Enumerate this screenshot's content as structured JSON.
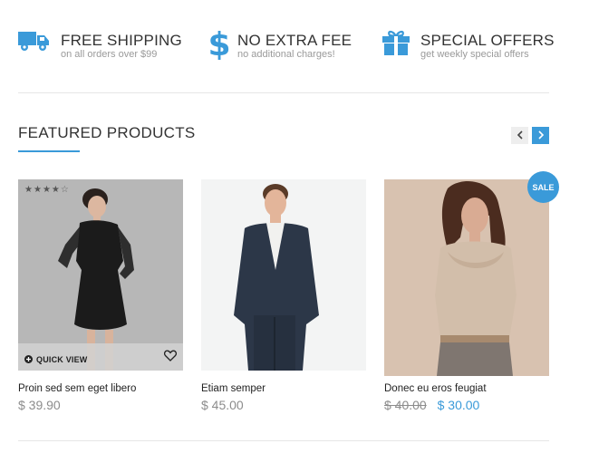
{
  "features": [
    {
      "icon": "truck-icon",
      "title": "FREE SHIPPING",
      "subtitle": "on all orders over $99"
    },
    {
      "icon": "dollar-icon",
      "title": "NO EXTRA FEE",
      "subtitle": "no additional charges!"
    },
    {
      "icon": "gift-icon",
      "title": "SPECIAL OFFERS",
      "subtitle": "get weekly special offers"
    }
  ],
  "featured": {
    "title": "FEATURED PRODUCTS",
    "nav": {
      "prev_icon": "chevron-left-icon",
      "next_icon": "chevron-right-icon"
    }
  },
  "products": [
    {
      "name": "Proin sed sem eget libero",
      "price": "$ 39.90",
      "rating": 4,
      "rating_max": 5,
      "quick_view_label": "QUICK VIEW"
    },
    {
      "name": "Etiam semper",
      "price": "$ 45.00"
    },
    {
      "name": "Donec eu eros feugiat",
      "old_price": "$ 40.00",
      "new_price": "$ 30.00",
      "badge": "SALE"
    }
  ],
  "colors": {
    "accent": "#3a9ad9",
    "muted": "#8c8c8c"
  }
}
